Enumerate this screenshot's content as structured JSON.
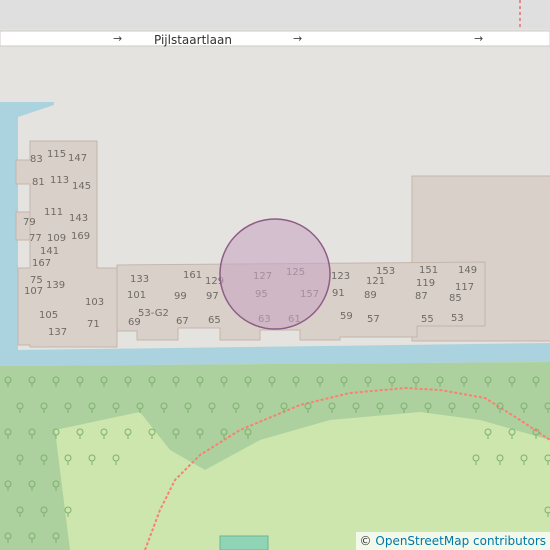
{
  "map": {
    "street_name": "Pijlstaartlaan",
    "one_way_arrow": "→",
    "house_numbers": {
      "left_block": [
        "83",
        "115",
        "147",
        "81",
        "113",
        "145",
        "111",
        "143",
        "79",
        "77",
        "109",
        "169",
        "141",
        "167",
        "75",
        "139",
        "107",
        "103",
        "105",
        "137",
        "71"
      ],
      "main_block": [
        "133",
        "161",
        "129",
        "127",
        "125",
        "123",
        "153",
        "151",
        "149",
        "101",
        "99",
        "97",
        "95",
        "157",
        "91",
        "121",
        "89",
        "119",
        "87",
        "117",
        "85",
        "53-G2",
        "69",
        "67",
        "65",
        "63",
        "61",
        "59",
        "57",
        "55",
        "53"
      ]
    },
    "marker": {
      "type": "circle",
      "fill": "#c8a6c3",
      "stroke": "#8e5d87"
    },
    "colors": {
      "land": "#e5e3df",
      "water": "#aad3df",
      "building": "#d9d0c9",
      "building_outline": "#c4b6ab",
      "road": "#ffffff",
      "park": "#c8e0a6",
      "wood": "#add19e",
      "path": "#fa8072"
    }
  },
  "attribution": {
    "symbol": "©",
    "link_text": "OpenStreetMap contributors"
  }
}
